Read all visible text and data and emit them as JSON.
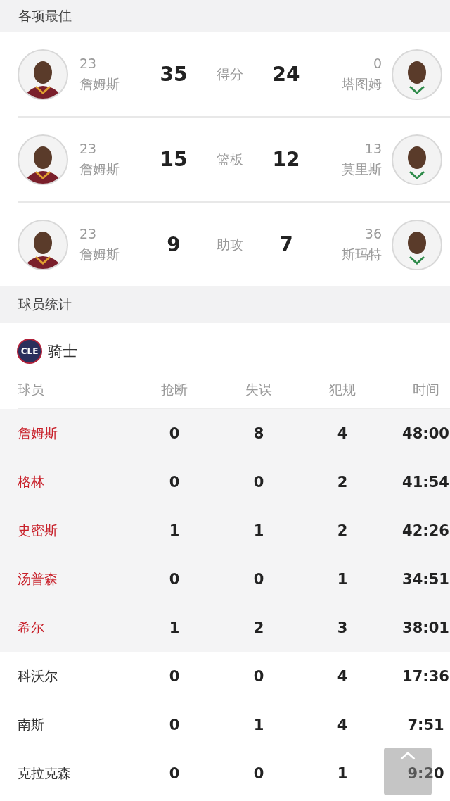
{
  "leaders_section": {
    "title": "各项最佳"
  },
  "leaders": [
    {
      "stat": "得分",
      "left": {
        "number": "23",
        "name": "詹姆斯",
        "value": "35"
      },
      "right": {
        "number": "0",
        "name": "塔图姆",
        "value": "24"
      }
    },
    {
      "stat": "篮板",
      "left": {
        "number": "23",
        "name": "詹姆斯",
        "value": "15"
      },
      "right": {
        "number": "13",
        "name": "莫里斯",
        "value": "12"
      }
    },
    {
      "stat": "助攻",
      "left": {
        "number": "23",
        "name": "詹姆斯",
        "value": "9"
      },
      "right": {
        "number": "36",
        "name": "斯玛特",
        "value": "7"
      }
    }
  ],
  "stats_section": {
    "title": "球员统计"
  },
  "team": {
    "logo": "CLE",
    "name": "骑士"
  },
  "table": {
    "columns": [
      "球员",
      "抢断",
      "失误",
      "犯规",
      "时间"
    ],
    "rows": [
      {
        "starter": true,
        "cells": [
          "詹姆斯",
          "0",
          "8",
          "4",
          "48:00"
        ]
      },
      {
        "starter": true,
        "cells": [
          "格林",
          "0",
          "0",
          "2",
          "41:54"
        ]
      },
      {
        "starter": true,
        "cells": [
          "史密斯",
          "1",
          "1",
          "2",
          "42:26"
        ]
      },
      {
        "starter": true,
        "cells": [
          "汤普森",
          "0",
          "0",
          "1",
          "34:51"
        ]
      },
      {
        "starter": true,
        "cells": [
          "希尔",
          "1",
          "2",
          "3",
          "38:01"
        ]
      },
      {
        "starter": false,
        "cells": [
          "科沃尔",
          "0",
          "0",
          "4",
          "17:36"
        ]
      },
      {
        "starter": false,
        "cells": [
          "南斯",
          "0",
          "1",
          "4",
          "7:51"
        ]
      },
      {
        "starter": false,
        "cells": [
          "克拉克森",
          "0",
          "0",
          "1",
          "9:20"
        ]
      }
    ]
  }
}
